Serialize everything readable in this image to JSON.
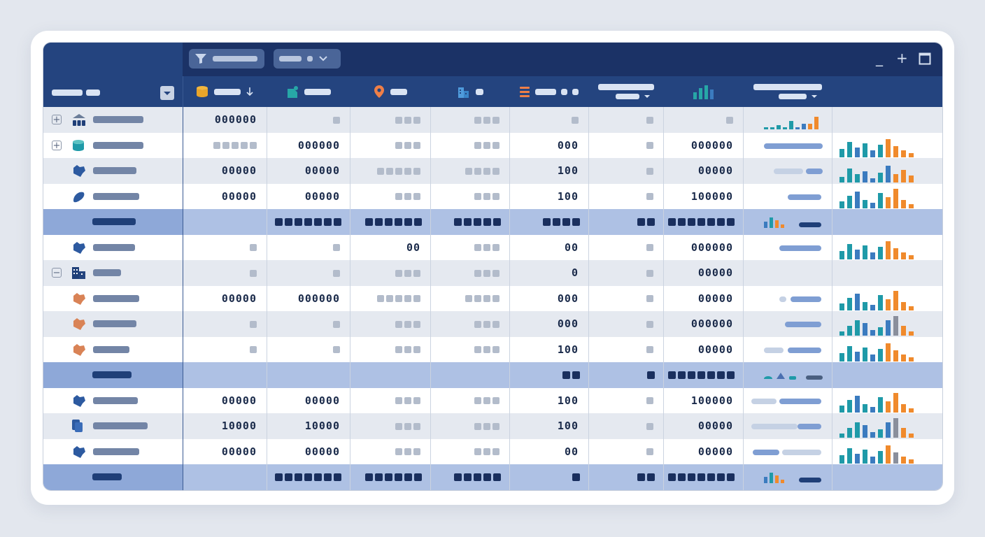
{
  "window": {
    "controls": [
      "_",
      "+"
    ]
  },
  "icons": {
    "filter": "filter-icon",
    "dropdown": "chevron-down-icon",
    "sort": "arrow-down-icon",
    "database": "database-icon",
    "document": "document-icon",
    "location": "location-pin-icon",
    "building": "building-icon",
    "list": "list-icon",
    "chart": "bar-chart-icon",
    "maximize": "window-maximize-icon"
  },
  "colors": {
    "toolbar": "#1b3266",
    "header": "#24447f",
    "group_row": "#aec1e4",
    "spark_teal": "#1f9aa8",
    "spark_blue": "#3b7bbf",
    "spark_orange": "#f08a2c",
    "spark_gray": "#8a8f9c"
  },
  "rows": [
    {
      "kind": "parent",
      "expander": "+",
      "icon": "people-icon",
      "c1": "000000",
      "c2": "",
      "c3": "",
      "c4": "",
      "c5": "",
      "c6": "",
      "c7": ""
    },
    {
      "kind": "parent",
      "expander": "+",
      "icon": "database-icon",
      "c1": "",
      "c2": "000000",
      "c3": "",
      "c4": "",
      "c5": "000",
      "c6": "",
      "c7": "000000"
    },
    {
      "kind": "child",
      "icon": "map-region-icon",
      "c1": "00000",
      "c2": "00000",
      "c3": "",
      "c4": "",
      "c5": "100",
      "c6": "",
      "c7": "00000"
    },
    {
      "kind": "child",
      "icon": "map-region-icon",
      "c1": "00000",
      "c2": "00000",
      "c3": "",
      "c4": "",
      "c5": "100",
      "c6": "",
      "c7": "100000"
    },
    {
      "kind": "group"
    },
    {
      "kind": "child",
      "icon": "map-region-icon",
      "c1": "",
      "c2": "",
      "c3": "00",
      "c4": "",
      "c5": "00",
      "c6": "",
      "c7": "000000"
    },
    {
      "kind": "parent",
      "expander": "−",
      "icon": "building-icon",
      "c1": "",
      "c2": "",
      "c3": "",
      "c4": "",
      "c5": "0",
      "c6": "",
      "c7": "00000"
    },
    {
      "kind": "child",
      "icon": "map-region-icon",
      "c1": "00000",
      "c2": "000000",
      "c3": "",
      "c4": "",
      "c5": "000",
      "c6": "",
      "c7": "00000"
    },
    {
      "kind": "child",
      "icon": "map-region-icon",
      "c1": "",
      "c2": "",
      "c3": "",
      "c4": "",
      "c5": "000",
      "c6": "",
      "c7": "000000"
    },
    {
      "kind": "child",
      "icon": "map-region-icon",
      "c1": "",
      "c2": "",
      "c3": "",
      "c4": "",
      "c5": "100",
      "c6": "",
      "c7": "00000"
    },
    {
      "kind": "group"
    },
    {
      "kind": "child",
      "icon": "map-region-icon",
      "c1": "00000",
      "c2": "00000",
      "c3": "",
      "c4": "",
      "c5": "100",
      "c6": "",
      "c7": "100000"
    },
    {
      "kind": "child",
      "icon": "document-icon",
      "c1": "10000",
      "c2": "10000",
      "c3": "",
      "c4": "",
      "c5": "100",
      "c6": "",
      "c7": "00000"
    },
    {
      "kind": "child",
      "icon": "map-region-icon",
      "c1": "00000",
      "c2": "00000",
      "c3": "",
      "c4": "",
      "c5": "00",
      "c6": "",
      "c7": "00000"
    },
    {
      "kind": "group"
    }
  ]
}
